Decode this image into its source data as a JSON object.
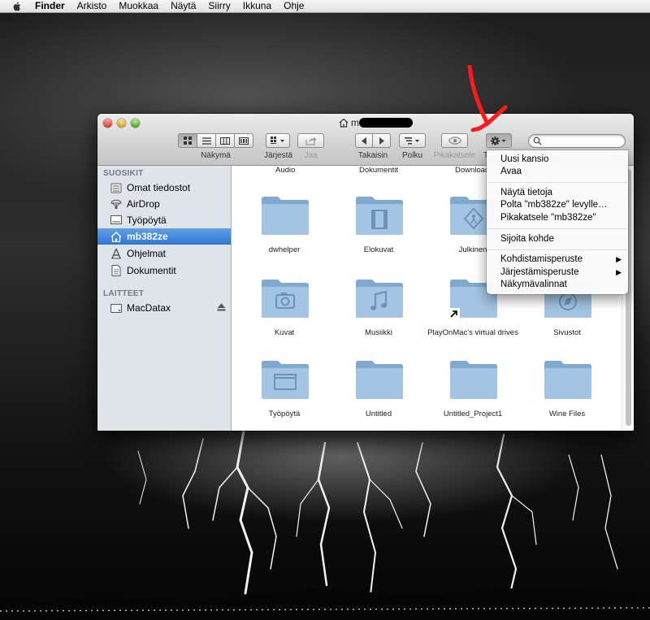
{
  "menubar": {
    "items": [
      "Finder",
      "Arkisto",
      "Muokkaa",
      "Näytä",
      "Siirry",
      "Ikkuna",
      "Ohje"
    ]
  },
  "window": {
    "title": "m"
  },
  "toolbar": {
    "view_label": "Näkymä",
    "arrange_label": "Järjestä",
    "share_label": "Jaa",
    "back_label": "Takaisin",
    "path_label": "Polku",
    "quicklook_label": "Pikakatsele",
    "action_label_fragment": "T"
  },
  "sidebar": {
    "favorites_header": "SUOSIKIT",
    "favorites": [
      "Omat tiedostot",
      "AirDrop",
      "Työpöytä",
      "mb382ze",
      "Ohjelmat",
      "Dokumentit"
    ],
    "devices_header": "LAITTEET",
    "devices": [
      "MacDatax"
    ]
  },
  "content": {
    "top_labels": [
      "Audio",
      "Dokumentit",
      "Download"
    ],
    "items": [
      {
        "label": "dwhelper",
        "icon": "folder"
      },
      {
        "label": "Elokuvat",
        "icon": "movies-folder"
      },
      {
        "label": "Julkinen",
        "icon": "public-folder"
      },
      {
        "label": "Kuvat",
        "icon": "pictures-folder"
      },
      {
        "label": "Musiikki",
        "icon": "music-folder"
      },
      {
        "label": "PlayOnMac's virtual drives",
        "icon": "alias-folder"
      },
      {
        "label": "Sivustot",
        "icon": "sites-folder"
      },
      {
        "label": "Työpöytä",
        "icon": "desktop-folder"
      },
      {
        "label": "Untitled",
        "icon": "folder"
      },
      {
        "label": "Untitled_Project1",
        "icon": "folder"
      },
      {
        "label": "Wine Files",
        "icon": "folder"
      }
    ]
  },
  "action_menu": {
    "group1": [
      "Uusi kansio",
      "Avaa"
    ],
    "group2": [
      "Näytä tietoja",
      "Polta \"mb382ze\" levylle…",
      "Pikakatsele \"mb382ze\""
    ],
    "group3": [
      "Sijoita kohde"
    ],
    "group4": [
      "Kohdistamisperuste",
      "Järjestämisperuste",
      "Näkymävalinnat"
    ]
  },
  "colors": {
    "sidebar_bg": "#dee4ea",
    "selection": "#2f76d3",
    "folder_blue": "#8fb6d9",
    "annotation_red": "#ff1a1a"
  }
}
